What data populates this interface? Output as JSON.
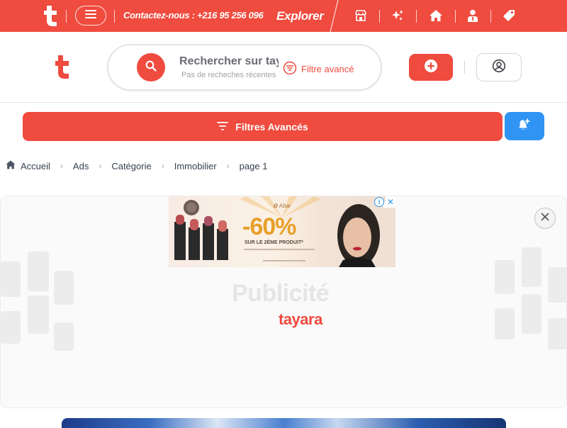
{
  "topbar": {
    "contact": "Contactez-nous : +216 95 256 096",
    "explorer": "Explorer",
    "icons": [
      "store-icon",
      "sparkle-icon",
      "home-icon",
      "user-tie-icon",
      "tag-icon"
    ],
    "color": "#ef4b3f"
  },
  "header": {
    "search_placeholder": "Rechercher sur tayara",
    "recent": "Pas de recheches récentes",
    "advanced_filter": "Filtre avancé"
  },
  "filters": {
    "label": "Filtres Avancés",
    "alert_color": "#2f94f3"
  },
  "breadcrumb": [
    {
      "label": "Accueil"
    },
    {
      "label": "Ads"
    },
    {
      "label": "Catégorie"
    },
    {
      "label": "Immobilier"
    },
    {
      "label": "page 1"
    }
  ],
  "ad": {
    "discount": "-60%",
    "offer": "SUR LE 2ÈME PRODUIT*",
    "publicite": "Publicité",
    "brand": "tayara"
  }
}
